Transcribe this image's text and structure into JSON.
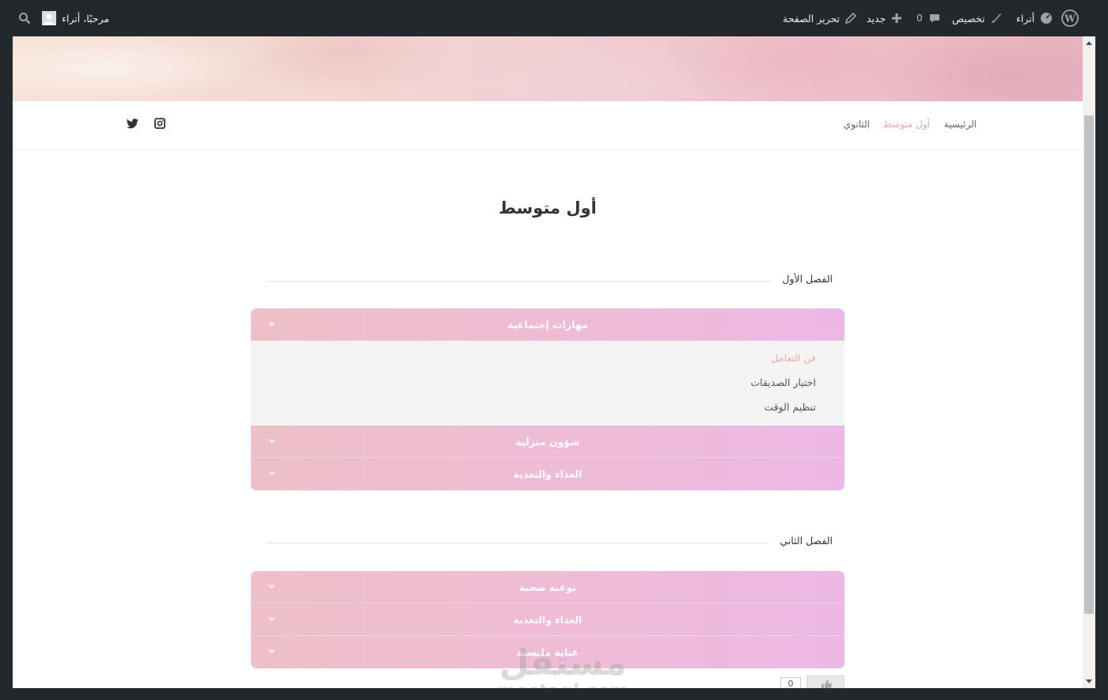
{
  "adminbar": {
    "site_name": "أتراء",
    "customize": "تخصيص",
    "comments_count": "0",
    "new": "جديد",
    "edit_page": "تحرير الصفحة",
    "greeting": "مرحبًا، أتراء"
  },
  "nav": {
    "items": [
      "الرئيسية",
      "أول متوسط",
      "الثانوي"
    ],
    "active": "أول متوسط"
  },
  "page": {
    "title": "أول متوسط"
  },
  "sections": [
    {
      "title": "الفصل الأول",
      "panels": [
        {
          "title": "مهارات إجتماعية",
          "expanded": true,
          "links": [
            "فن التعامل",
            "اختيار الصديقات",
            "تنظيم الوقت"
          ]
        },
        {
          "title": "شؤون منزلية",
          "expanded": false
        },
        {
          "title": "الغذاء والتغذية",
          "expanded": false
        }
      ]
    },
    {
      "title": "الفصل الثاني",
      "panels": [
        {
          "title": "توعية صحية",
          "expanded": false
        },
        {
          "title": "الغذاء والتغذية",
          "expanded": false
        },
        {
          "title": "عناية ملبسية",
          "expanded": false
        }
      ]
    }
  ],
  "like": {
    "count": "0"
  },
  "watermark": {
    "ar": "مستقل",
    "en": "mostaql.com"
  },
  "colors": {
    "accent": "#e7a9a6",
    "accordion_start": "#edc0c8",
    "accordion_end": "#ecb9e6",
    "adminbar": "#23282d"
  }
}
